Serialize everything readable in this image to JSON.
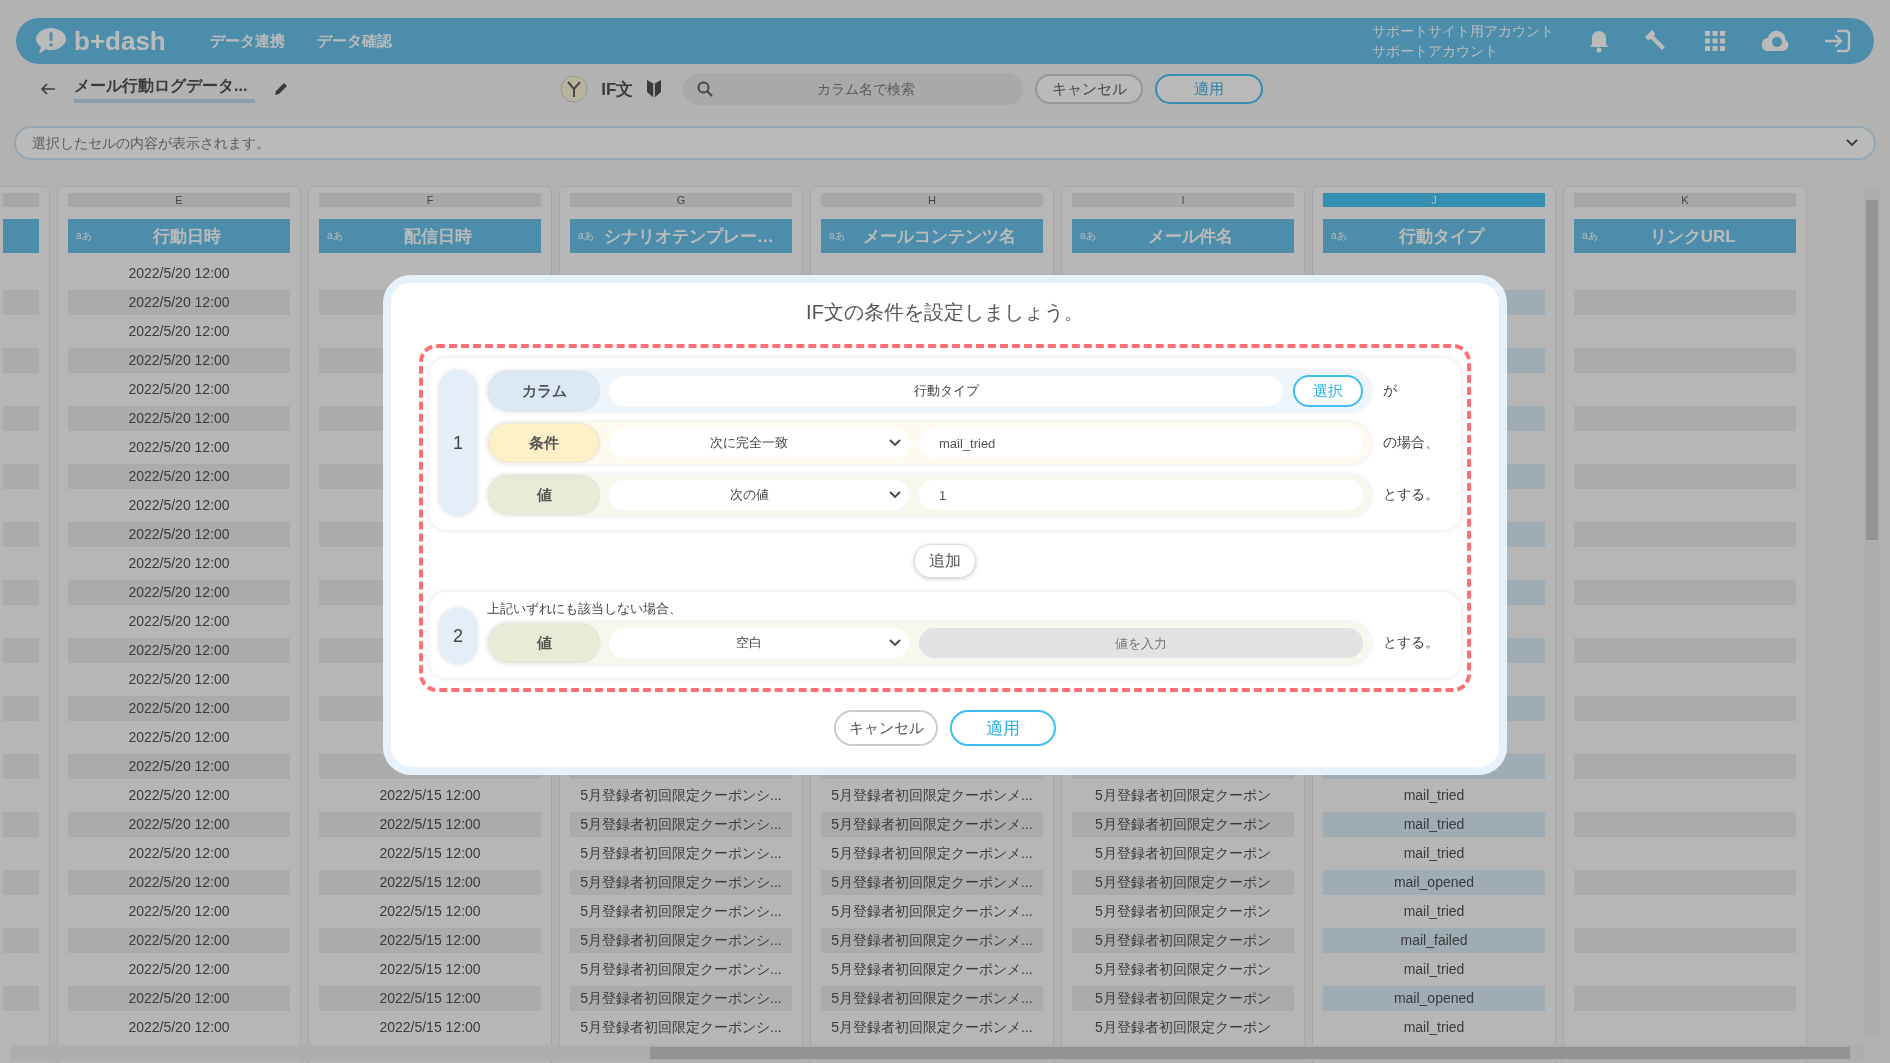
{
  "header": {
    "logo": "b+dash",
    "nav": [
      {
        "label": "データ連携"
      },
      {
        "label": "データ確認"
      }
    ],
    "account": {
      "site": "サポートサイト用アカウント",
      "user": "サポートアカウント"
    }
  },
  "toolbar": {
    "title": "メール行動ログデータ...",
    "mode": "IF文",
    "search": {
      "placeholder": "カラム名で検索"
    },
    "buttons": [
      {
        "label": "キャンセル",
        "kind": "secondary"
      },
      {
        "label": "適用",
        "kind": "primary"
      }
    ]
  },
  "cell_view": {
    "placeholder": "選択したセルの内容が表示されます。"
  },
  "table": {
    "columns": [
      {
        "letter": "E",
        "header": "行動日時",
        "type_badge": "aあ",
        "selected": false
      },
      {
        "letter": "F",
        "header": "配信日時",
        "type_badge": "aあ",
        "selected": false
      },
      {
        "letter": "G",
        "header": "シナリオテンプレー…",
        "type_badge": "aあ",
        "selected": false
      },
      {
        "letter": "H",
        "header": "メールコンテンツ名",
        "type_badge": "aあ",
        "selected": false
      },
      {
        "letter": "I",
        "header": "メール件名",
        "type_badge": "aあ",
        "selected": false
      },
      {
        "letter": "J",
        "header": "行動タイプ",
        "type_badge": "aあ",
        "selected": true
      },
      {
        "letter": "K",
        "header": "リンクURL",
        "type_badge": "aあ",
        "selected": false
      }
    ],
    "rows": [
      [
        "2022/5/20 12:00",
        null,
        null,
        null,
        null,
        null,
        null
      ],
      [
        "2022/5/20 12:00",
        null,
        null,
        null,
        null,
        null,
        null
      ],
      [
        "2022/5/20 12:00",
        null,
        null,
        null,
        null,
        null,
        null
      ],
      [
        "2022/5/20 12:00",
        null,
        null,
        null,
        null,
        null,
        null
      ],
      [
        "2022/5/20 12:00",
        null,
        null,
        null,
        null,
        null,
        null
      ],
      [
        "2022/5/20 12:00",
        null,
        null,
        null,
        null,
        null,
        null
      ],
      [
        "2022/5/20 12:00",
        null,
        null,
        null,
        null,
        null,
        null
      ],
      [
        "2022/5/20 12:00",
        null,
        null,
        null,
        null,
        null,
        null
      ],
      [
        "2022/5/20 12:00",
        null,
        null,
        null,
        null,
        null,
        null
      ],
      [
        "2022/5/20 12:00",
        null,
        null,
        null,
        null,
        null,
        null
      ],
      [
        "2022/5/20 12:00",
        null,
        null,
        null,
        null,
        null,
        null
      ],
      [
        "2022/5/20 12:00",
        null,
        null,
        null,
        null,
        null,
        null
      ],
      [
        "2022/5/20 12:00",
        null,
        null,
        null,
        null,
        null,
        null
      ],
      [
        "2022/5/20 12:00",
        null,
        null,
        null,
        null,
        null,
        null
      ],
      [
        "2022/5/20 12:00",
        null,
        null,
        null,
        null,
        null,
        null
      ],
      [
        "2022/5/20 12:00",
        null,
        null,
        null,
        null,
        null,
        null
      ],
      [
        "2022/5/20 12:00",
        null,
        null,
        null,
        null,
        null,
        null
      ],
      [
        "2022/5/20 12:00",
        null,
        null,
        null,
        null,
        null,
        null
      ],
      [
        "2022/5/20 12:00",
        "2022/5/15 12:00",
        "5月登録者初回限定クーポンシ...",
        "5月登録者初回限定クーポンメ...",
        "5月登録者初回限定クーポン",
        "mail_tried",
        null
      ],
      [
        "2022/5/20 12:00",
        "2022/5/15 12:00",
        "5月登録者初回限定クーポンシ...",
        "5月登録者初回限定クーポンメ...",
        "5月登録者初回限定クーポン",
        "mail_tried",
        null
      ],
      [
        "2022/5/20 12:00",
        "2022/5/15 12:00",
        "5月登録者初回限定クーポンシ...",
        "5月登録者初回限定クーポンメ...",
        "5月登録者初回限定クーポン",
        "mail_tried",
        null
      ],
      [
        "2022/5/20 12:00",
        "2022/5/15 12:00",
        "5月登録者初回限定クーポンシ...",
        "5月登録者初回限定クーポンメ...",
        "5月登録者初回限定クーポン",
        "mail_opened",
        null
      ],
      [
        "2022/5/20 12:00",
        "2022/5/15 12:00",
        "5月登録者初回限定クーポンシ...",
        "5月登録者初回限定クーポンメ...",
        "5月登録者初回限定クーポン",
        "mail_tried",
        null
      ],
      [
        "2022/5/20 12:00",
        "2022/5/15 12:00",
        "5月登録者初回限定クーポンシ...",
        "5月登録者初回限定クーポンメ...",
        "5月登録者初回限定クーポン",
        "mail_failed",
        null
      ],
      [
        "2022/5/20 12:00",
        "2022/5/15 12:00",
        "5月登録者初回限定クーポンシ...",
        "5月登録者初回限定クーポンメ...",
        "5月登録者初回限定クーポン",
        "mail_tried",
        null
      ],
      [
        "2022/5/20 12:00",
        "2022/5/15 12:00",
        "5月登録者初回限定クーポンシ...",
        "5月登録者初回限定クーポンメ...",
        "5月登録者初回限定クーポン",
        "mail_opened",
        null
      ],
      [
        "2022/5/20 12:00",
        "2022/5/15 12:00",
        "5月登録者初回限定クーポンシ...",
        "5月登録者初回限定クーポンメ...",
        "5月登録者初回限定クーポン",
        "mail_tried",
        null
      ]
    ]
  },
  "modal": {
    "title": "IF文の条件を設定しましょう。",
    "blocks": [
      {
        "number": "1",
        "rows": [
          {
            "kind": "column",
            "label": "カラム",
            "value": "行動タイプ",
            "button": "選択",
            "suffix": "が",
            "disabled": false
          },
          {
            "kind": "condition",
            "label": "条件",
            "dropdown": "次に完全一致",
            "input": "mail_tried",
            "suffix": "の場合、",
            "disabled": false
          },
          {
            "kind": "value",
            "label": "値",
            "dropdown": "次の値",
            "input": "1",
            "suffix": "とする。",
            "disabled": false
          }
        ]
      }
    ],
    "add_button": "追加",
    "else_block": {
      "number": "2",
      "note": "上記いずれにも該当しない場合、",
      "rows": [
        {
          "kind": "value",
          "label": "値",
          "dropdown": "空白",
          "placeholder": "値を入力",
          "suffix": "とする。",
          "disabled": true
        }
      ]
    },
    "buttons": [
      {
        "label": "キャンセル",
        "kind": "secondary"
      },
      {
        "label": "適用",
        "kind": "primary"
      }
    ]
  }
}
